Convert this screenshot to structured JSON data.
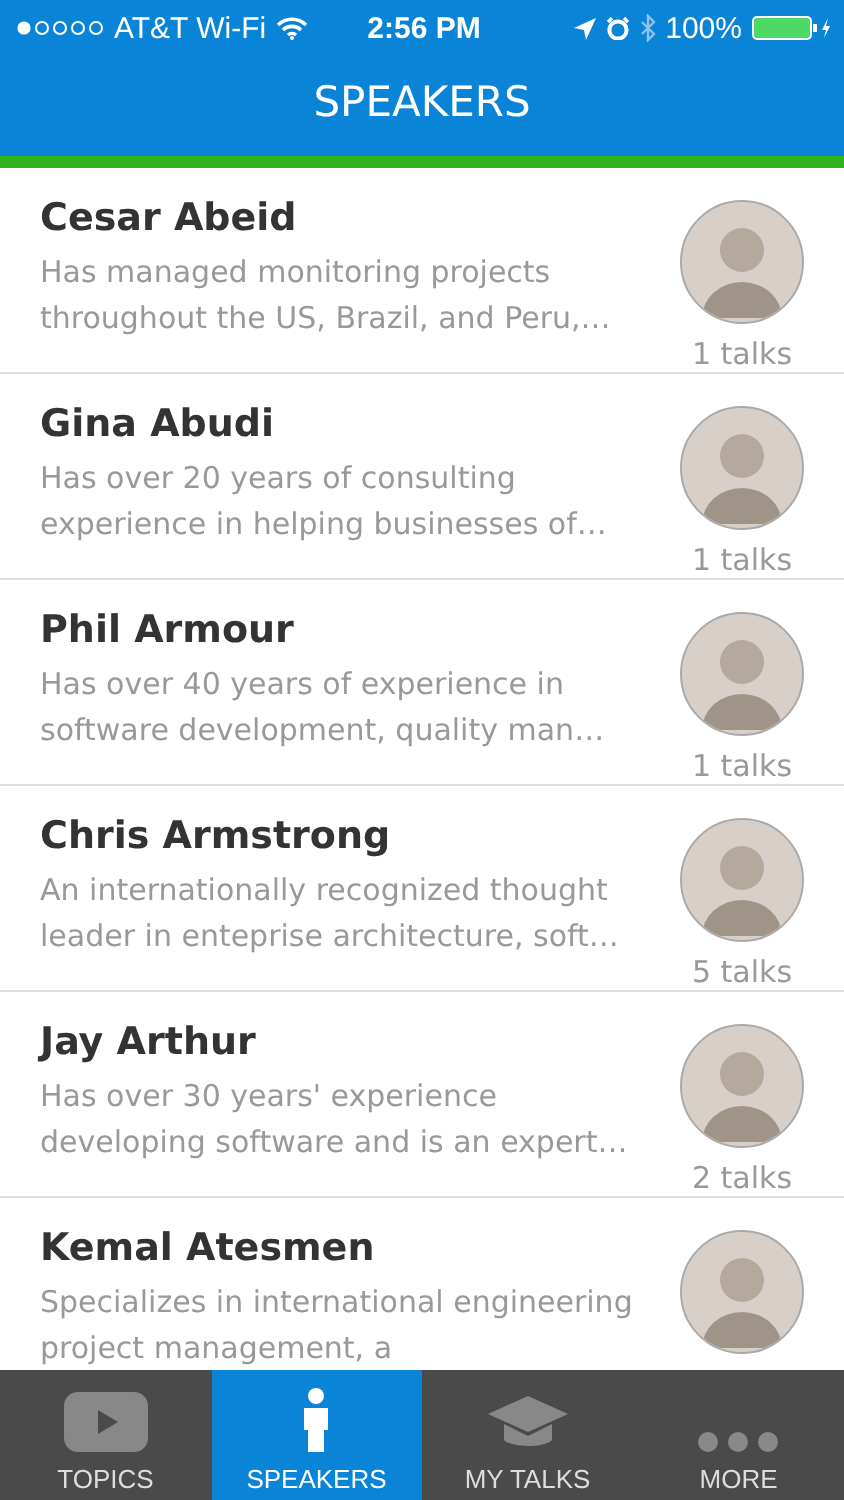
{
  "status_bar": {
    "carrier": "AT&T Wi-Fi",
    "time": "2:56 PM",
    "battery": "100%"
  },
  "header": {
    "title": "SPEAKERS"
  },
  "speakers": [
    {
      "name": "Cesar Abeid",
      "bio": "Has managed monitoring projects throughout the US, Brazil, and Peru,…",
      "talks": "1 talks"
    },
    {
      "name": "Gina Abudi",
      "bio": "Has over 20 years of consulting experience in helping businesses of…",
      "talks": "1 talks"
    },
    {
      "name": "Phil Armour",
      "bio": "Has over 40 years of experience in software development, quality man…",
      "talks": "1 talks"
    },
    {
      "name": "Chris Armstrong",
      "bio": "An internationally recognized thought leader in enteprise architecture, soft…",
      "talks": "5 talks"
    },
    {
      "name": "Jay Arthur",
      "bio": "Has over 30 years' experience developing software and is an expert…",
      "talks": "2 talks"
    },
    {
      "name": "Kemal Atesmen",
      "bio": "Specializes in international engineering project management, a"
    }
  ],
  "tabs": [
    {
      "kind": "topics",
      "label": "TOPICS",
      "selected": false
    },
    {
      "kind": "speakers",
      "label": "SPEAKERS",
      "selected": true
    },
    {
      "kind": "mytalks",
      "label": "MY TALKS",
      "selected": false
    },
    {
      "kind": "more",
      "label": "MORE",
      "selected": false
    }
  ]
}
